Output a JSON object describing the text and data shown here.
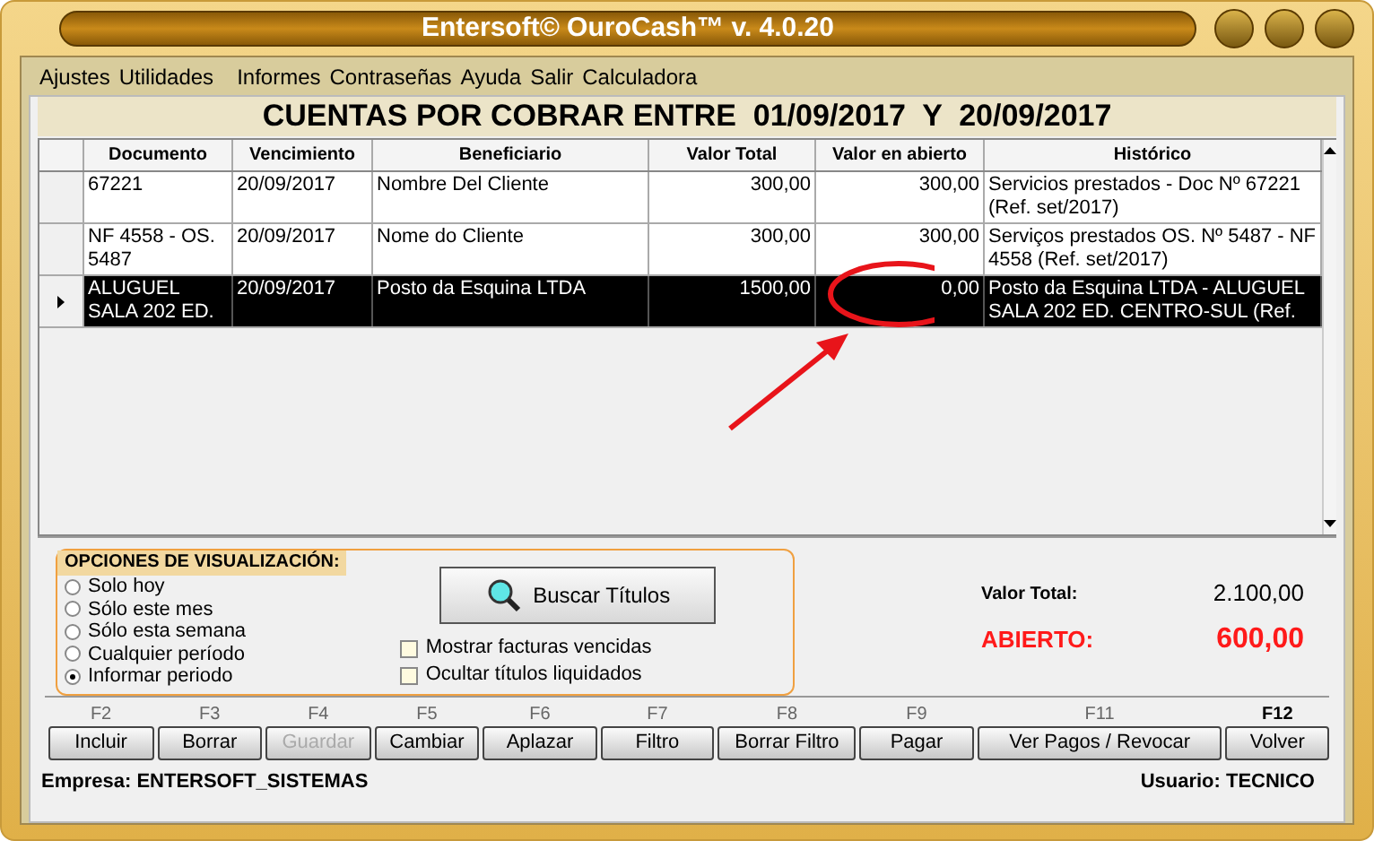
{
  "window": {
    "title": "Entersoft© OuroCash™ v. 4.0.20"
  },
  "menu": [
    "Ajustes",
    "Utilidades",
    "Informes",
    "Contraseñas",
    "Ayuda",
    "Salir",
    "Calculadora"
  ],
  "heading": "CUENTAS POR COBRAR ENTRE  01/09/2017  Y  20/09/2017",
  "table": {
    "columns": [
      "Documento",
      "Vencimiento",
      "Beneficiario",
      "Valor Total",
      "Valor en abierto",
      "Histórico"
    ],
    "rows": [
      {
        "selected": false,
        "cells": [
          "67221",
          "20/09/2017",
          "Nombre Del Cliente",
          "300,00",
          "300,00",
          "Servicios prestados - Doc Nº 67221 (Ref. set/2017)"
        ]
      },
      {
        "selected": false,
        "cells": [
          "NF 4558 - OS. 5487",
          "20/09/2017",
          "Nome do Cliente",
          "300,00",
          "300,00",
          "Serviços prestados OS. Nº 5487 - NF 4558 (Ref. set/2017)"
        ]
      },
      {
        "selected": true,
        "cells": [
          "ALUGUEL SALA 202 ED.",
          "20/09/2017",
          "Posto da Esquina LTDA",
          "1500,00",
          "0,00",
          "Posto da Esquina LTDA - ALUGUEL SALA 202 ED. CENTRO-SUL (Ref."
        ]
      }
    ]
  },
  "options": {
    "title": "OPCIONES DE VISUALIZACIÓN:",
    "radios": [
      {
        "label": "Solo hoy",
        "selected": false
      },
      {
        "label": "Sólo este mes",
        "selected": false
      },
      {
        "label": "Sólo esta semana",
        "selected": false
      },
      {
        "label": "Cualquier período",
        "selected": false
      },
      {
        "label": "Informar periodo",
        "selected": true
      }
    ],
    "search_button": "Buscar Títulos",
    "checkboxes": [
      {
        "label": "Mostrar facturas vencidas",
        "checked": false
      },
      {
        "label": "Ocultar títulos liquidados",
        "checked": false
      }
    ]
  },
  "summary": {
    "total_label": "Valor Total:",
    "total": "2.100,00",
    "open_label": "ABIERTO:",
    "open": "600,00"
  },
  "buttons": [
    {
      "key": "F2",
      "label": "Incluir",
      "disabled": false,
      "emphasized": false
    },
    {
      "key": "F3",
      "label": "Borrar",
      "disabled": false,
      "emphasized": false
    },
    {
      "key": "F4",
      "label": "Guardar",
      "disabled": true,
      "emphasized": false
    },
    {
      "key": "F5",
      "label": "Cambiar",
      "disabled": false,
      "emphasized": false
    },
    {
      "key": "F6",
      "label": "Aplazar",
      "disabled": false,
      "emphasized": false
    },
    {
      "key": "F7",
      "label": "Filtro",
      "disabled": false,
      "emphasized": false
    },
    {
      "key": "F8",
      "label": "Borrar Filtro",
      "disabled": false,
      "emphasized": false
    },
    {
      "key": "F9",
      "label": "Pagar",
      "disabled": false,
      "emphasized": false
    },
    {
      "key": "F11",
      "label": "Ver Pagos / Revocar",
      "disabled": false,
      "emphasized": false
    },
    {
      "key": "F12",
      "label": "Volver",
      "disabled": false,
      "emphasized": true
    }
  ],
  "status_bar": {
    "company": "Empresa: ENTERSOFT_SISTEMAS",
    "user": "Usuario: TECNICO"
  }
}
